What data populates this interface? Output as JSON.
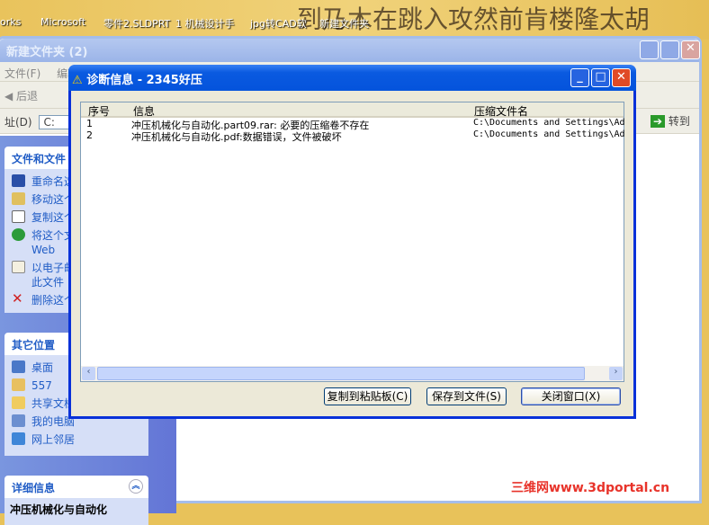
{
  "desktop": {
    "icons": [
      "orks",
      "Microsoft",
      "零件2.SLDPRT",
      "1 机械设计手",
      "jpg转CAD软",
      "新建文件夹"
    ],
    "calligraphy": "到乃木在跳入攻然前肯楼隆太胡"
  },
  "explorer": {
    "title": "新建文件夹 (2)",
    "menu": [
      "文件(F)",
      "编辑"
    ],
    "back": "后退",
    "address_label": "址(D)",
    "address_value": "C:",
    "go": "转到",
    "panel_tasks": {
      "title": "文件和文件",
      "items": [
        "重命名这",
        "移动这个",
        "复制这个",
        "将这个文\nWeb",
        "以电子邮\n此文件",
        "删除这个"
      ]
    },
    "panel_places": {
      "title": "其它位置",
      "items": [
        "桌面",
        "557",
        "共享文档",
        "我的电脑",
        "网上邻居"
      ]
    },
    "panel_details": {
      "title": "详细信息",
      "filename": "冲压机械化与自动化"
    }
  },
  "dialog": {
    "title": "诊断信息 - 2345好压",
    "columns": [
      "序号",
      "信息",
      "压缩文件名"
    ],
    "rows": [
      {
        "no": "1",
        "info": "冲压机械化与自动化.part09.rar: 必要的压缩卷不存在",
        "file": "C:\\Documents and Settings\\Ad"
      },
      {
        "no": "2",
        "info": "冲压机械化与自动化.pdf:数据错误，文件被破坏",
        "file": "C:\\Documents and Settings\\Ad"
      }
    ],
    "buttons": {
      "copy": "复制到粘贴板(C)",
      "save": "保存到文件(S)",
      "close": "关闭窗口(X)"
    }
  },
  "watermark": "三维网www.3dportal.cn"
}
